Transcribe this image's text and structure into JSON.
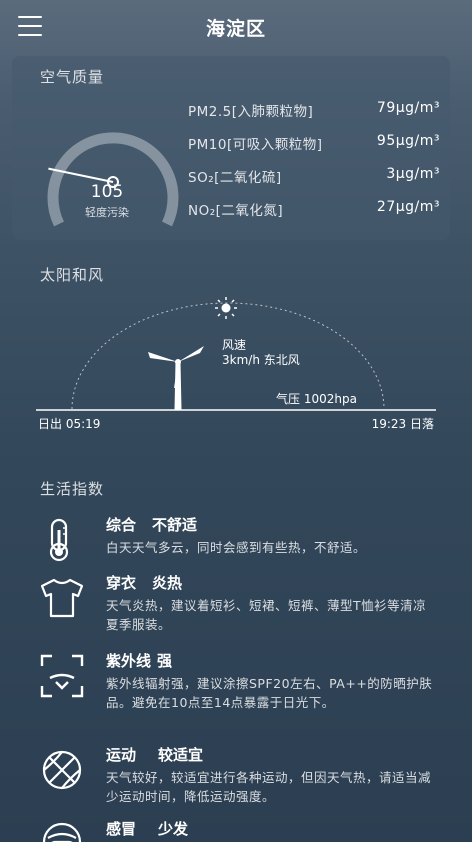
{
  "header": {
    "title": "海淀区",
    "menu_icon": "hamburger-menu-icon"
  },
  "air_quality": {
    "title": "空气质量",
    "aqi": "105",
    "aqi_fraction": 0.21,
    "level": "轻度污染",
    "pollutants": [
      {
        "name": "PM2.5[入肺颗粒物]",
        "value": "79μg/m³"
      },
      {
        "name": "PM10[可吸入颗粒物]",
        "value": "95μg/m³"
      },
      {
        "name": "SO₂[二氧化硫]",
        "value": "3μg/m³"
      },
      {
        "name": "NO₂[二氧化氮]",
        "value": "27μg/m³"
      }
    ]
  },
  "sun_wind": {
    "title": "太阳和风",
    "wind_label": "风速",
    "wind_value": "3km/h 东北风",
    "pressure": "气压 1002hpa",
    "sunrise": "日出 05:19",
    "sunset": "19:23 日落",
    "sun_icon": "sun-icon",
    "windmill_icon": "wind-turbine-icon"
  },
  "life_index": {
    "title": "生活指数",
    "items": [
      {
        "name": "综合",
        "level": "不舒适",
        "desc": "白天天气多云，同时会感到有些热，不舒适。",
        "icon": "thermometer-icon"
      },
      {
        "name": "穿衣",
        "level": "炎热",
        "desc": "天气炎热，建议着短衫、短裙、短裤、薄型T恤衫等清凉夏季服装。",
        "icon": "tshirt-icon"
      },
      {
        "name": "紫外线",
        "level": "强",
        "desc": "紫外线辐射强，建议涂擦SPF20左右、PA++的防晒护肤品。避免在10点至14点暴露于日光下。",
        "icon": "uv-scan-icon"
      },
      {
        "name": "运动",
        "level": "较适宜",
        "desc": "天气较好，较适宜进行各种运动，但因天气热，请适当减少运动时间，降低运动强度。",
        "icon": "basketball-icon"
      },
      {
        "name": "感冒",
        "level": "少发",
        "desc": "",
        "icon": "mask-face-icon"
      }
    ]
  }
}
